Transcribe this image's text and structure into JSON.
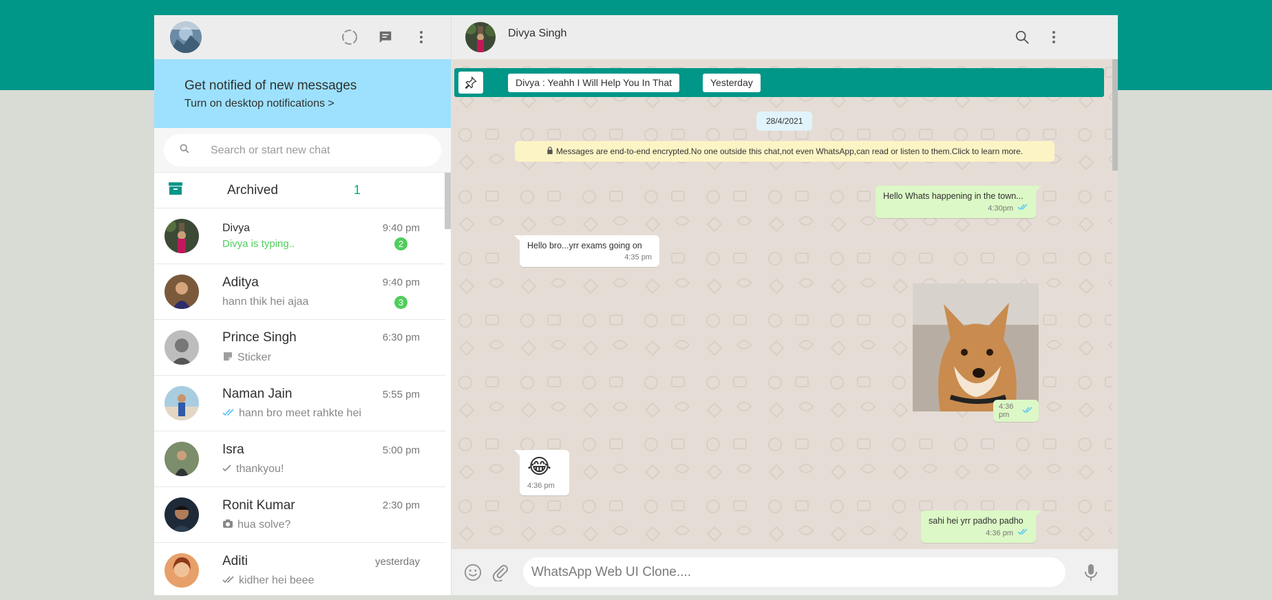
{
  "sidebar": {
    "notify_title": "Get notified of new messages",
    "notify_link": "Turn on desktop notifications >",
    "search_placeholder": "Search or start new chat",
    "archived_label": "Archived",
    "archived_count": "1",
    "chats": [
      {
        "name": "Divya",
        "time": "9:40 pm",
        "message": "Divya is typing..",
        "status": "typing",
        "unread": "2"
      },
      {
        "name": "Aditya",
        "time": "9:40 pm",
        "message": "hann thik hei ajaa",
        "status": "none",
        "unread": "3"
      },
      {
        "name": "Prince Singh",
        "time": "6:30 pm",
        "message": "Sticker",
        "status": "sticker",
        "unread": ""
      },
      {
        "name": "Naman Jain",
        "time": "5:55 pm",
        "message": "hann bro meet rahkte hei",
        "status": "read",
        "unread": ""
      },
      {
        "name": "Isra",
        "time": "5:00 pm",
        "message": "thankyou!",
        "status": "sent",
        "unread": ""
      },
      {
        "name": "Ronit Kumar",
        "time": "2:30 pm",
        "message": "hua solve?",
        "status": "photo",
        "unread": ""
      },
      {
        "name": "Aditi",
        "time": "yesterday",
        "message": "kidher hei beee",
        "status": "delivered",
        "unread": ""
      }
    ]
  },
  "chat": {
    "contact_name": "Divya Singh",
    "pinned_message": "Divya : Yeahh I Will Help You In That",
    "pinned_date": "Yesterday",
    "date_chip": "28/4/2021",
    "encryption_notice": "Messages are end-to-end encrypted.No one outside this chat,not even WhatsApp,can read or listen to them.Click to learn more.",
    "messages": [
      {
        "text": "Hello Whats happening in the town...",
        "time": "4:30pm",
        "direction": "out"
      },
      {
        "text": "Hello bro...yrr exams going on",
        "time": "4:35 pm",
        "direction": "in"
      },
      {
        "text": "",
        "time": "4:36 pm",
        "direction": "out",
        "kind": "image"
      },
      {
        "text": "😂",
        "time": "4:36 pm",
        "direction": "in",
        "kind": "emoji"
      },
      {
        "text": "sahi hei yrr padho padho",
        "time": "4:36 pm",
        "direction": "out"
      }
    ],
    "composer_placeholder": "WhatsApp Web UI Clone...."
  },
  "colors": {
    "teal": "#009688",
    "page_bg": "#d9dbd5",
    "notify_bg": "#9de1fe",
    "unread_green": "#4fce5d",
    "out_bubble": "#dcf8c6",
    "chat_bg": "#e5ddd5"
  },
  "icons": {
    "header": [
      "status-icon",
      "new-chat-icon",
      "menu-dots-icon"
    ],
    "chat_header": [
      "search-icon",
      "menu-dots-icon"
    ],
    "footer": [
      "emoji-icon",
      "attach-icon",
      "mic-icon"
    ]
  }
}
